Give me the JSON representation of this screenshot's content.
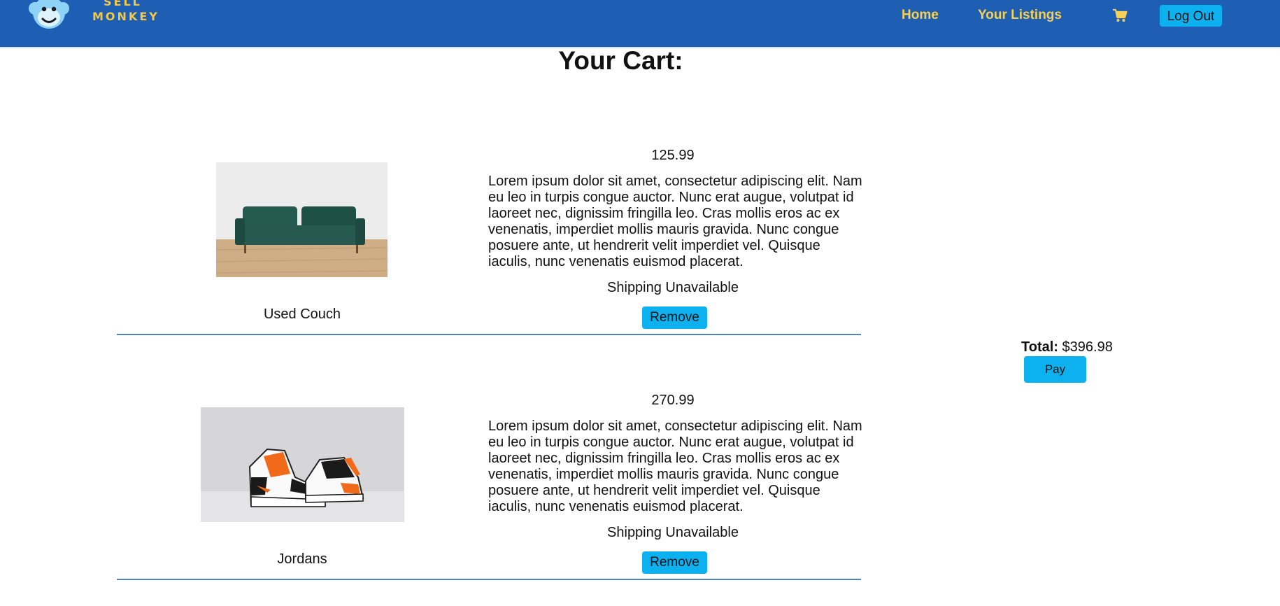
{
  "brand": {
    "line1": "SELL",
    "line2": "MONKEY"
  },
  "nav": {
    "home": "Home",
    "listings": "Your Listings",
    "cart_icon": "shopping-cart-icon",
    "logout": "Log Out"
  },
  "page": {
    "title": "Your Cart:"
  },
  "items": [
    {
      "name": "Used Couch",
      "price": "125.99",
      "description": "Lorem ipsum dolor sit amet, consectetur adipiscing elit. Nam eu leo in turpis congue auctor. Nunc erat augue, volutpat id laoreet nec, dignissim fringilla leo. Cras mollis eros ac ex venenatis, imperdiet mollis mauris gravida. Nunc congue posuere ante, ut hendrerit velit imperdiet vel. Quisque iaculis, nunc venenatis euismod placerat.",
      "shipping": "Shipping Unavailable",
      "remove_label": "Remove"
    },
    {
      "name": "Jordans",
      "price": "270.99",
      "description": "Lorem ipsum dolor sit amet, consectetur adipiscing elit. Nam eu leo in turpis congue auctor. Nunc erat augue, volutpat id laoreet nec, dignissim fringilla leo. Cras mollis eros ac ex venenatis, imperdiet mollis mauris gravida. Nunc congue posuere ante, ut hendrerit velit imperdiet vel. Quisque iaculis, nunc venenatis euismod placerat.",
      "shipping": "Shipping Unavailable",
      "remove_label": "Remove"
    }
  ],
  "summary": {
    "total_label": "Total:",
    "total_value": "$396.98",
    "pay_label": "Pay"
  },
  "colors": {
    "navbar": "#1f5fb3",
    "nav_link": "#f6d155",
    "button": "#0db1f0",
    "divider": "#4d82c4"
  }
}
